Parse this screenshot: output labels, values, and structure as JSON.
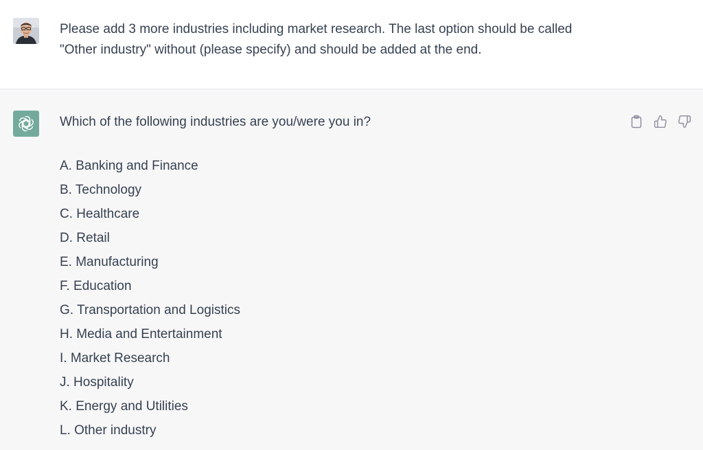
{
  "user_message": {
    "avatar": "user-avatar-photo",
    "text": "Please add 3 more industries including market research. The last option should be called \"Other industry\" without (please specify) and should be added at the end."
  },
  "assistant_message": {
    "avatar": "openai-logo",
    "intro": "Which of the following industries are you/were you in?",
    "options": [
      "A. Banking and Finance",
      "B. Technology",
      "C. Healthcare",
      "D. Retail",
      "E. Manufacturing",
      "F. Education",
      "G. Transportation and Logistics",
      "H. Media and Entertainment",
      "I. Market Research",
      "J. Hospitality",
      "K. Energy and Utilities",
      "L. Other industry"
    ],
    "actions": [
      {
        "icon": "clipboard-icon"
      },
      {
        "icon": "thumbs-up-icon"
      },
      {
        "icon": "thumbs-down-icon"
      }
    ]
  },
  "colors": {
    "user_bg": "#ffffff",
    "assistant_bg": "#f7f7f8",
    "text": "#374151",
    "bot_avatar": "#74aa9c",
    "icon": "#8e8ea0"
  }
}
